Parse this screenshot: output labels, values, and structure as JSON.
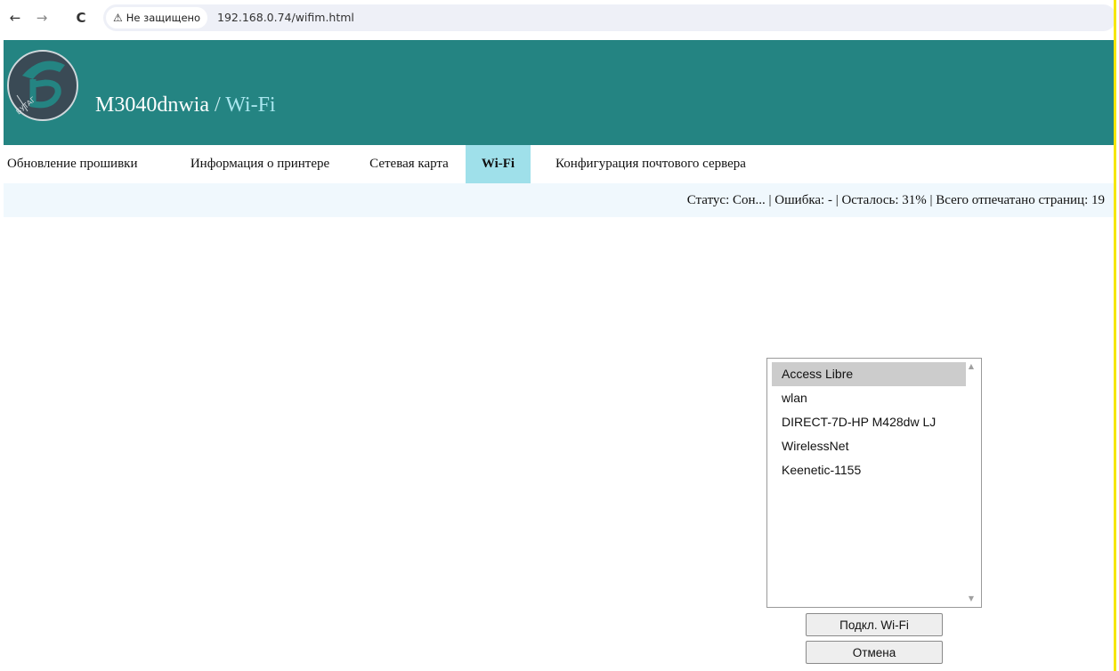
{
  "browser": {
    "back_icon": "←",
    "forward_icon": "→",
    "reload_icon": "C",
    "security_label": "Не защищено",
    "url": "192.168.0.74/wifim.html"
  },
  "header": {
    "model": "M3040dnwia",
    "separator": " / ",
    "section": "Wi-Fi",
    "logo_text": "БУТАГ"
  },
  "tabs": [
    {
      "label": "Обновление прошивки",
      "active": false
    },
    {
      "label": "Информация о принтере",
      "active": false
    },
    {
      "label": "Сетевая карта",
      "active": false
    },
    {
      "label": "Wi-Fi",
      "active": true
    },
    {
      "label": "Конфигурация почтового сервера",
      "active": false
    }
  ],
  "status": {
    "text": "Статус: Сон...  | Ошибка: -  | Осталось: 31%  | Всего отпечатано страниц: 19"
  },
  "networks": {
    "items": [
      "Access Libre",
      "wlan",
      "DIRECT-7D-HP M428dw LJ",
      "WirelessNet",
      "Keenetic-1155"
    ],
    "selected": "Access Libre"
  },
  "buttons": {
    "connect": "Подкл. Wi-Fi",
    "cancel": "Отмена"
  },
  "colors": {
    "banner": "#248482",
    "active_tab": "#9fe0ea",
    "status_bar": "#f0f8fd"
  }
}
